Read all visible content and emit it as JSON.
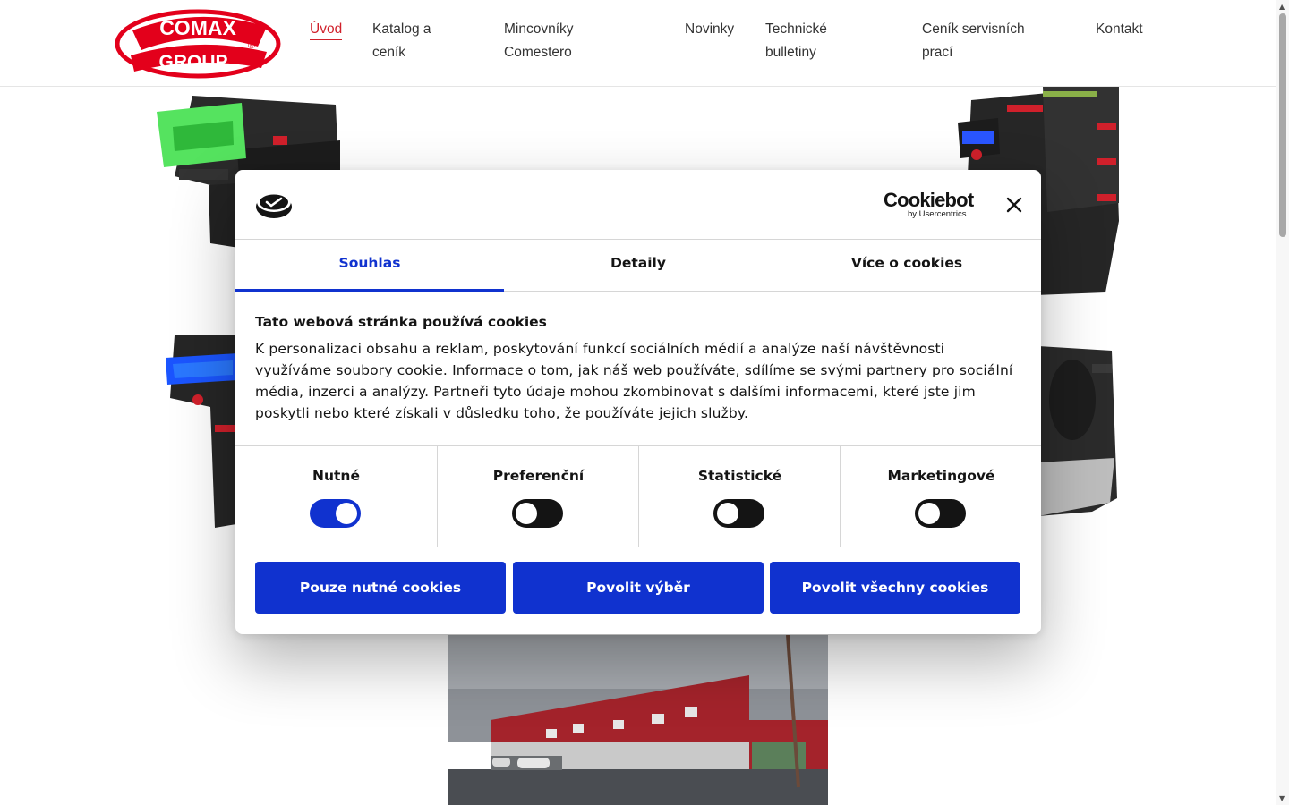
{
  "header": {
    "logo": {
      "top_text": "COMAX",
      "bottom_text": "GROUP",
      "mark": "®",
      "color": "#e3001b"
    },
    "nav": [
      {
        "label": "Úvod",
        "active": true
      },
      {
        "label": "Katalog a",
        "label2": "ceník"
      },
      {
        "label": "Mincovníky",
        "label2": "Comestero"
      },
      {
        "label": "Novinky"
      },
      {
        "label": "Technické",
        "label2": "bulletiny"
      },
      {
        "label": "Ceník servisních",
        "label2": "prací"
      },
      {
        "label": "Kontakt"
      }
    ]
  },
  "dialog": {
    "brand": {
      "name": "Cookiebot",
      "sub": "by Usercentrics"
    },
    "close_icon": "close-icon",
    "tabs": [
      {
        "label": "Souhlas",
        "active": true
      },
      {
        "label": "Detaily"
      },
      {
        "label": "Více o cookies"
      }
    ],
    "title": "Tato webová stránka používá cookies",
    "text": "K personalizaci obsahu a reklam, poskytování funkcí sociálních médií a analýze naší návštěvnosti využíváme soubory cookie. Informace o tom, jak náš web používáte, sdílíme se svými partnery pro sociální média, inzerci a analýzy. Partneři tyto údaje mohou zkombinovat s dalšími informacemi, které jste jim poskytli nebo které získali v důsledku toho, že používáte jejich služby.",
    "toggles": [
      {
        "label": "Nutné",
        "on": true
      },
      {
        "label": "Preferenční",
        "on": false
      },
      {
        "label": "Statistické",
        "on": false
      },
      {
        "label": "Marketingové",
        "on": false
      }
    ],
    "buttons": {
      "necessary": "Pouze nutné cookies",
      "selection": "Povolit výběr",
      "all": "Povolit všechny cookies"
    },
    "accent_color": "#1032cf"
  }
}
